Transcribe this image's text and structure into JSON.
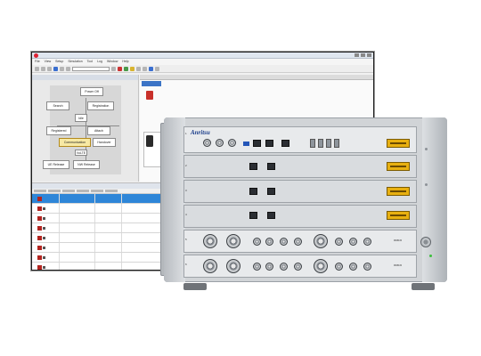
{
  "software": {
    "menu_items": [
      "File",
      "View",
      "Setup",
      "Simulation",
      "Tool",
      "Log",
      "Window",
      "Help"
    ],
    "toolbar_select_value": "",
    "left_pane_header": "",
    "flow_nodes": [
      "Power Off",
      "Search",
      "Registration",
      "Idle",
      "Registered",
      "Attach",
      "Communication",
      "Handover",
      "VoLTE",
      "UE Release",
      "NW Release"
    ],
    "log_header": "",
    "log_rows": 9
  },
  "instrument": {
    "brand": "Anritsu",
    "model": "",
    "slots": [
      "1",
      "2",
      "3",
      "4",
      "5",
      "6"
    ],
    "module_labels": [
      "MD8430",
      "MD8430"
    ]
  },
  "colors": {
    "selection_blue": "#2e86d8",
    "ue_red": "#c8302a",
    "lcd_amber": "#e8b010",
    "brand_blue": "#1b3d8a"
  }
}
